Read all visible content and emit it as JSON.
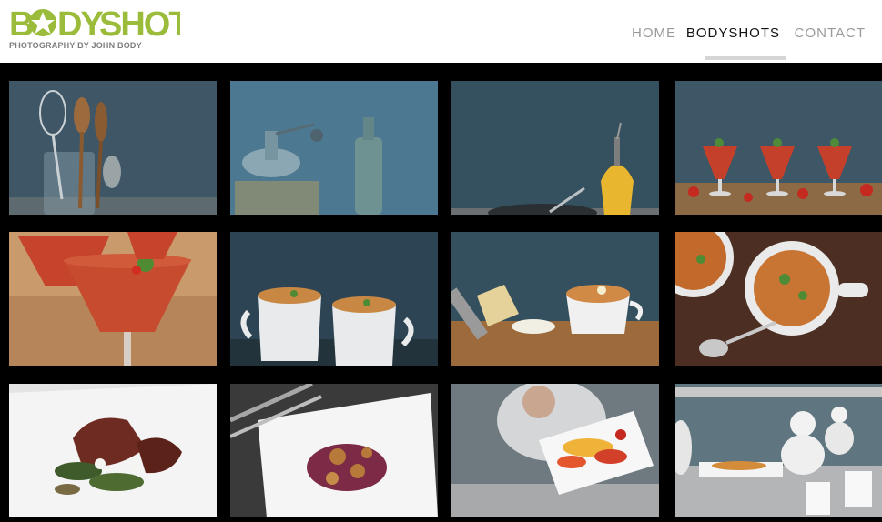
{
  "brand": {
    "logo_text": "BODYSHOTS",
    "tagline": "PHOTOGRAPHY BY JOHN BODY",
    "logo_color": "#9bbb3a"
  },
  "nav": {
    "items": [
      {
        "label": "HOME",
        "active": false
      },
      {
        "label": "BODYSHOTS",
        "active": true
      },
      {
        "label": "CONTACT",
        "active": false
      }
    ]
  },
  "gallery": {
    "tiles": [
      {
        "subject": "kitchen utensils in jar",
        "icon": "utensils-photo"
      },
      {
        "subject": "coffee grinder and bottle",
        "icon": "grinder-photo",
        "highlighted": true
      },
      {
        "subject": "olive oil cruet and pan",
        "icon": "oil-photo"
      },
      {
        "subject": "three glasses of gazpacho",
        "icon": "gazpacho-photo"
      },
      {
        "subject": "gazpacho close-up",
        "icon": "gazpacho-closeup-photo"
      },
      {
        "subject": "two mugs of soup",
        "icon": "soup-mugs-photo"
      },
      {
        "subject": "soup bowl with parmesan and grater",
        "icon": "parmesan-soup-photo"
      },
      {
        "subject": "stew bowls overhead",
        "icon": "stew-photo"
      },
      {
        "subject": "steak plate",
        "icon": "steak-photo"
      },
      {
        "subject": "slaw plate with cutlery",
        "icon": "slaw-photo"
      },
      {
        "subject": "chef holding pepper plate",
        "icon": "chef-plate-photo"
      },
      {
        "subject": "chefs at kitchen pass",
        "icon": "kitchen-pass-photo"
      }
    ]
  }
}
